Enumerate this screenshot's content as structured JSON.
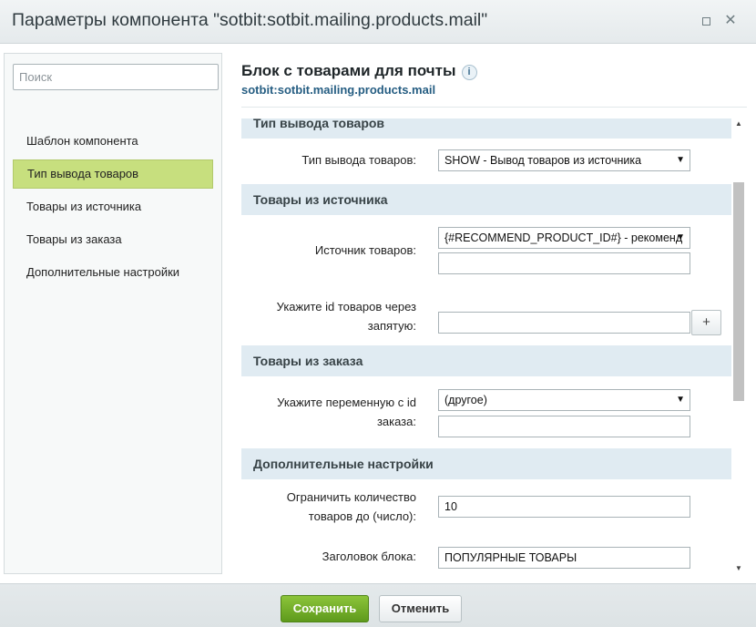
{
  "window": {
    "title": "Параметры компонента \"sotbit:sotbit.mailing.products.mail\"",
    "maximize_icon": "maximize-icon",
    "close_glyph": "✕"
  },
  "sidebar": {
    "search_placeholder": "Поиск",
    "items": [
      {
        "label": "Шаблон компонента",
        "active": false
      },
      {
        "label": "Тип вывода товаров",
        "active": true
      },
      {
        "label": "Товары из источника",
        "active": false
      },
      {
        "label": "Товары из заказа",
        "active": false
      },
      {
        "label": "Дополнительные настройки",
        "active": false
      }
    ]
  },
  "main": {
    "title": "Блок с товарами для почты",
    "info_glyph": "i",
    "component_id": "sotbit:sotbit.mailing.products.mail",
    "sections": {
      "output_type": {
        "title": "Тип вывода товаров",
        "output_type_label": "Тип вывода товаров:",
        "output_type_value": "SHOW - Вывод товаров из источника"
      },
      "source": {
        "title": "Товары из источника",
        "source_label": "Источник товаров:",
        "source_value": "{#RECOMMEND_PRODUCT_ID#} - рекоменд",
        "source_extra_value": "",
        "ids_label_line1": "Укажите id товаров через",
        "ids_label_line2": "запятую:",
        "ids_value": "",
        "add_button": "+"
      },
      "order": {
        "title": "Товары из заказа",
        "order_var_label_line1": "Укажите переменную с id",
        "order_var_label_line2": "заказа:",
        "order_var_value": "(другое)",
        "order_var_extra_value": ""
      },
      "extra": {
        "title": "Дополнительные настройки",
        "limit_label_line1": "Ограничить количество",
        "limit_label_line2": "товаров до (число):",
        "limit_value": "10",
        "header_label": "Заголовок блока:",
        "header_value": "ПОПУЛЯРНЫЕ ТОВАРЫ"
      }
    }
  },
  "footer": {
    "save_label": "Сохранить",
    "cancel_label": "Отменить"
  },
  "colors": {
    "save_button": "#6aa622",
    "active_nav": "#c7df7e",
    "section_bg": "#e0ebf2",
    "link": "#255d82"
  }
}
